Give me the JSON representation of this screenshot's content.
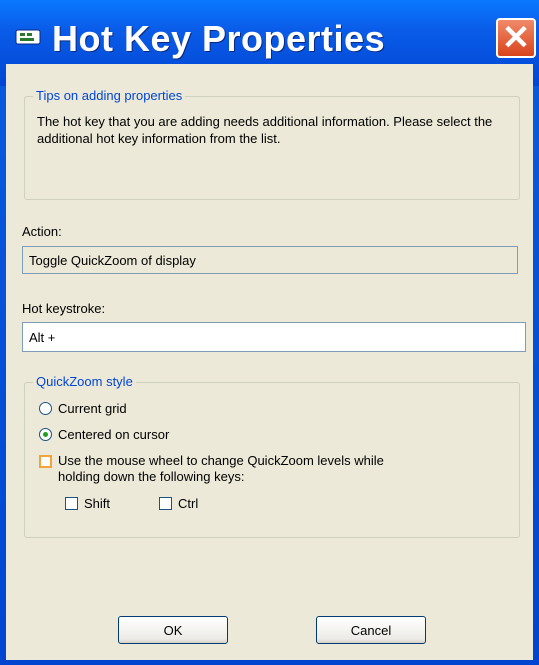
{
  "window": {
    "title": "Hot Key Properties",
    "close_glyph": "✕"
  },
  "tips": {
    "legend": "Tips on adding properties",
    "text": "The hot key that you are adding needs additional information. Please select the additional hot key information from the list."
  },
  "action": {
    "label": "Action:",
    "value": "Toggle QuickZoom of display"
  },
  "hotkey": {
    "label": "Hot keystroke:",
    "value": "Alt +"
  },
  "quickzoom": {
    "legend": "QuickZoom style",
    "option_current_grid": "Current grid",
    "option_centered": "Centered on cursor",
    "selected": "Centered on cursor",
    "mouse_wheel_label_line1": "Use the mouse wheel to change QuickZoom levels while",
    "mouse_wheel_label_line2": "holding down the following keys:",
    "mouse_wheel_checked": false,
    "shift_label": "Shift",
    "shift_checked": false,
    "ctrl_label": "Ctrl",
    "ctrl_checked": false
  },
  "buttons": {
    "ok": "OK",
    "cancel": "Cancel"
  },
  "colors": {
    "title_bar": "#0a5ce8",
    "legend_text": "#0046d5",
    "client_bg": "#ece9d8",
    "close_button": "#d8441c"
  },
  "icons": {
    "title": "window-app-icon",
    "close": "close-icon"
  }
}
